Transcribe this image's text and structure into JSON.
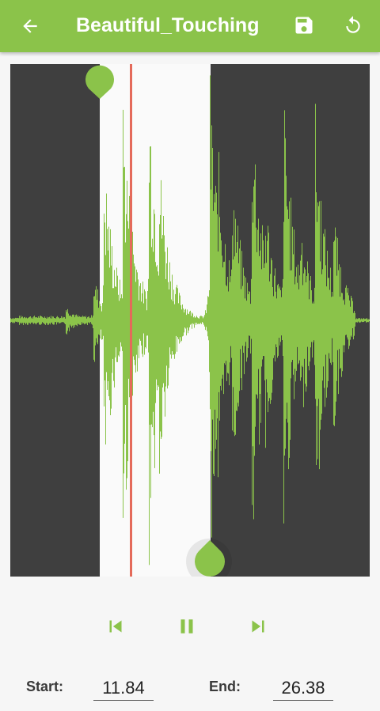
{
  "appbar": {
    "title": "Beautiful_Touching",
    "back_icon": "arrow-left-icon",
    "save_icon": "floppy-disk-icon",
    "reset_icon": "rotate-ccw-icon"
  },
  "colors": {
    "accent": "#8bc34a",
    "waveform": "#8bc34a",
    "dimmed": "#3f3f3f",
    "playhead": "#e46a5a"
  },
  "controls": {
    "prev_icon": "skip-previous-icon",
    "pause_icon": "pause-icon",
    "next_icon": "skip-next-icon"
  },
  "times": {
    "start_label": "Start:",
    "start_value": "11.84",
    "end_label": "End:",
    "end_value": "26.38"
  }
}
